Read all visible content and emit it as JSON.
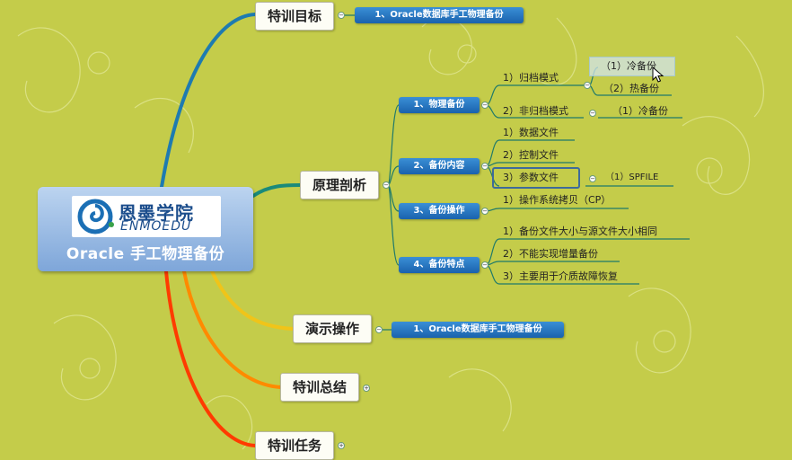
{
  "central": {
    "logo_cn": "恩墨学院",
    "logo_en": "ENMOEDU",
    "title": "Oracle 手工物理备份"
  },
  "topics": {
    "goal": {
      "label": "特训目标",
      "child": "1、Oracle数据库手工物理备份"
    },
    "principle": {
      "label": "原理剖析",
      "physical": {
        "label": "1、物理备份",
        "archive": {
          "label": "1）归档模式",
          "cold": "（1）冷备份",
          "hot": "（2）热备份"
        },
        "noarchive": {
          "label": "2）非归档模式",
          "cold": "（1）冷备份"
        }
      },
      "content": {
        "label": "2、备份内容",
        "items": [
          "1）数据文件",
          "2）控制文件",
          "3）参数文件"
        ],
        "spfile": "（1）SPFILE"
      },
      "operation": {
        "label": "3、备份操作",
        "item": "1）操作系统拷贝（CP）"
      },
      "features": {
        "label": "4、备份特点",
        "items": [
          "1）备份文件大小与源文件大小相同",
          "2）不能实现增量备份",
          "3）主要用于介质故障恢复"
        ]
      }
    },
    "demo": {
      "label": "演示操作",
      "child": "1、Oracle数据库手工物理备份"
    },
    "summary": {
      "label": "特训总结"
    },
    "task": {
      "label": "特训任务"
    }
  },
  "colors": {
    "background": "#c4cc4a",
    "branch_blue": "#1e7bb0",
    "branch_teal": "#1a8a7a",
    "branch_yellow": "#f0c419",
    "branch_orange": "#ff8a00",
    "branch_red": "#ff3b00",
    "pill_blue": "#2a7bc8"
  }
}
